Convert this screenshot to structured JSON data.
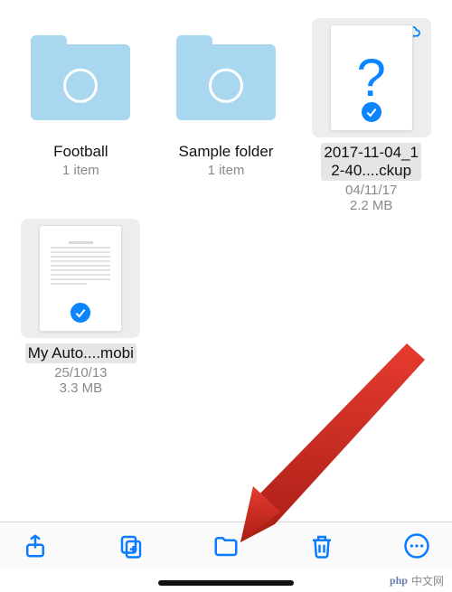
{
  "items": [
    {
      "kind": "folder",
      "name": "Football",
      "meta": "1 item",
      "selected": false
    },
    {
      "kind": "folder",
      "name": "Sample folder",
      "meta": "1 item",
      "selected": false
    },
    {
      "kind": "file-unknown",
      "name": "2017-11-04_1\n2-40....ckup",
      "meta": "04/11/17",
      "meta2": "2.2 MB",
      "selected": true,
      "cloud": true
    },
    {
      "kind": "file-doc",
      "name": "My Auto....mobi",
      "meta": "25/10/13",
      "meta2": "3.3 MB",
      "selected": true,
      "cloud": false
    }
  ],
  "toolbar": {
    "share": "share-icon",
    "duplicate": "duplicate-icon",
    "move": "folder-icon",
    "delete": "trash-icon",
    "more": "more-icon"
  },
  "watermark": {
    "prefix": "php",
    "text": "中文网"
  }
}
